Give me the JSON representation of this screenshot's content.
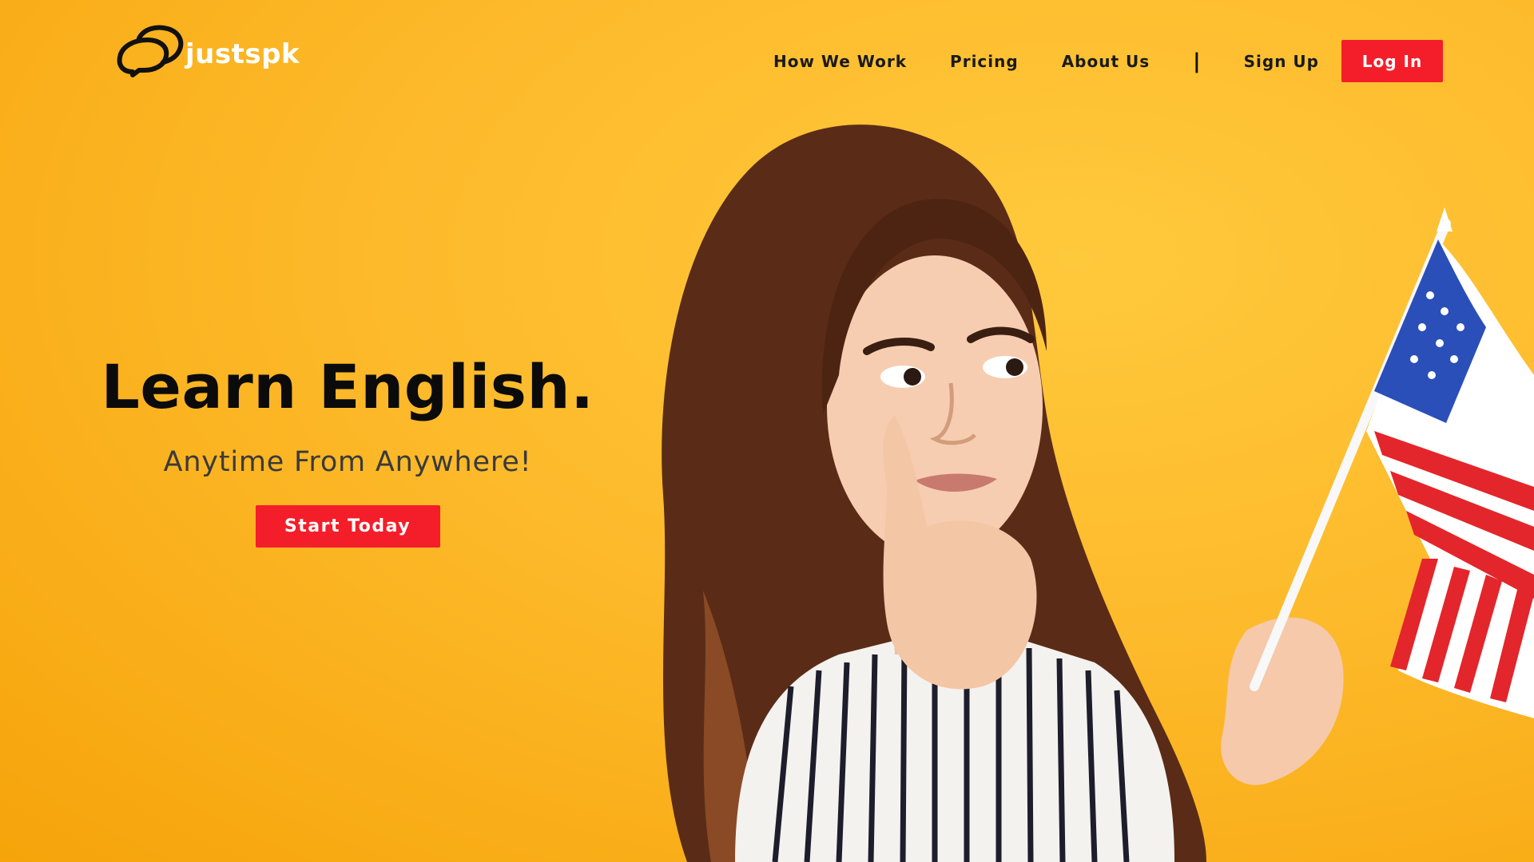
{
  "brand": {
    "name": "justspk",
    "logo_icon": "speech-bubble-icon"
  },
  "nav": {
    "items": [
      {
        "label": "How We Work"
      },
      {
        "label": "Pricing"
      },
      {
        "label": "About Us"
      }
    ],
    "divider": "|",
    "signup_label": "Sign Up",
    "login_label": "Log In"
  },
  "hero": {
    "title": "Learn English.",
    "subtitle": "Anytime From Anywhere!",
    "cta_label": "Start Today"
  },
  "colors": {
    "background": "#FDBA2B",
    "accent": "#F41E2A",
    "text_dark": "#0b0b0b"
  },
  "photo": {
    "subject": "woman-holding-us-flag-photo"
  }
}
